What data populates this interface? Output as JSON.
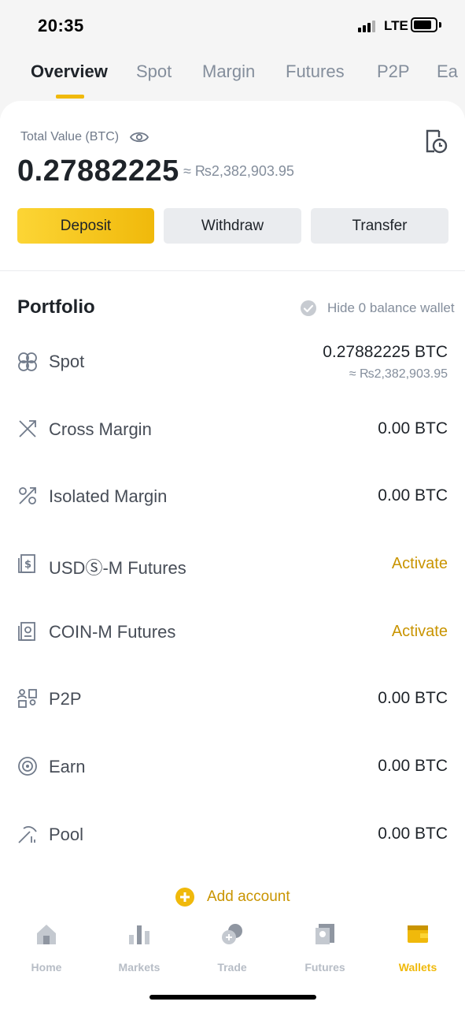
{
  "status_bar": {
    "time": "20:35",
    "network": "LTE"
  },
  "tabs": [
    {
      "label": "Overview",
      "active": true
    },
    {
      "label": "Spot",
      "active": false
    },
    {
      "label": "Margin",
      "active": false
    },
    {
      "label": "Futures",
      "active": false
    },
    {
      "label": "P2P",
      "active": false
    },
    {
      "label": "Ea",
      "active": false
    }
  ],
  "overview": {
    "total_label": "Total Value (BTC)",
    "total_btc": "0.27882225",
    "total_fiat": "≈ ₨2,382,903.95",
    "buttons": {
      "deposit": "Deposit",
      "withdraw": "Withdraw",
      "transfer": "Transfer"
    }
  },
  "portfolio": {
    "title": "Portfolio",
    "hide_zero_label": "Hide 0 balance wallet",
    "accounts": [
      {
        "name": "Spot",
        "icon": "spot-icon",
        "value": "0.27882225 BTC",
        "sub": "≈ ₨2,382,903.95"
      },
      {
        "name": "Cross Margin",
        "icon": "cross-margin-icon",
        "value": "0.00 BTC"
      },
      {
        "name": "Isolated Margin",
        "icon": "isolated-margin-icon",
        "value": "0.00 BTC"
      },
      {
        "name": "USDⓈ-M Futures",
        "icon": "usds-futures-icon",
        "action": "Activate"
      },
      {
        "name": "COIN-M Futures",
        "icon": "coin-futures-icon",
        "action": "Activate"
      },
      {
        "name": "P2P",
        "icon": "p2p-icon",
        "value": "0.00 BTC"
      },
      {
        "name": "Earn",
        "icon": "earn-icon",
        "value": "0.00 BTC"
      },
      {
        "name": "Pool",
        "icon": "pool-icon",
        "value": "0.00 BTC"
      }
    ],
    "add_account": "Add account"
  },
  "bottom_nav": [
    {
      "label": "Home",
      "icon": "home-icon",
      "active": false
    },
    {
      "label": "Markets",
      "icon": "markets-icon",
      "active": false
    },
    {
      "label": "Trade",
      "icon": "trade-icon",
      "active": false
    },
    {
      "label": "Futures",
      "icon": "futures-icon",
      "active": false
    },
    {
      "label": "Wallets",
      "icon": "wallets-icon",
      "active": true
    }
  ],
  "colors": {
    "accent": "#f0b90b",
    "activate": "#c99400",
    "text_primary": "#1e2329",
    "text_secondary": "#848e9c"
  }
}
